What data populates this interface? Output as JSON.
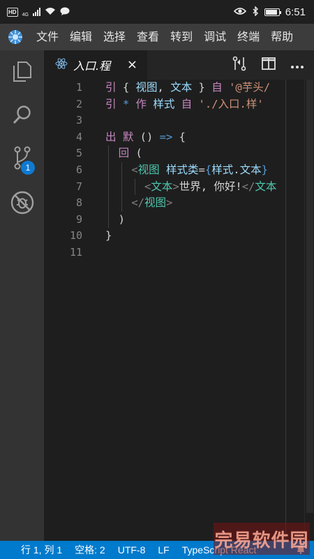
{
  "status_bar": {
    "hd": "HD",
    "network": "4G",
    "time": "6:51",
    "battery_level": 0.9
  },
  "menu": {
    "items": [
      "文件",
      "编辑",
      "选择",
      "查看",
      "转到",
      "调试",
      "终端",
      "帮助"
    ]
  },
  "activity_bar": {
    "items": [
      "explorer-icon",
      "search-icon",
      "source-control-icon",
      "extensions-icon"
    ],
    "scm_badge": "1"
  },
  "tab": {
    "title": "入口.程",
    "close": "×"
  },
  "editor": {
    "line_numbers": [
      "1",
      "2",
      "3",
      "4",
      "5",
      "6",
      "7",
      "8",
      "9",
      "10",
      "11"
    ],
    "lines": [
      [
        [
          "kw",
          "引 "
        ],
        [
          "pun",
          "{ "
        ],
        [
          "var",
          "视图"
        ],
        [
          "pun",
          ", "
        ],
        [
          "var",
          "文本"
        ],
        [
          "pun",
          " } "
        ],
        [
          "kw",
          "自 "
        ],
        [
          "str",
          "'@芋头/"
        ]
      ],
      [
        [
          "kw",
          "引 "
        ],
        [
          "op",
          "* "
        ],
        [
          "kw",
          "作 "
        ],
        [
          "var",
          "样式 "
        ],
        [
          "kw",
          "自 "
        ],
        [
          "str",
          "'./入口.样'"
        ]
      ],
      [],
      [
        [
          "kw",
          "出 默 "
        ],
        [
          "pun",
          "() "
        ],
        [
          "op",
          "=> "
        ],
        [
          "pun",
          "{"
        ]
      ],
      [
        [
          "pun",
          "  "
        ],
        [
          "kw",
          "回 "
        ],
        [
          "pun",
          "("
        ]
      ],
      [
        [
          "pun",
          "    "
        ],
        [
          "brk",
          "<"
        ],
        [
          "tag",
          "视图 "
        ],
        [
          "var",
          "样式类"
        ],
        [
          "pun",
          "="
        ],
        [
          "op",
          "{"
        ],
        [
          "var",
          "样式"
        ],
        [
          "pun",
          "."
        ],
        [
          "var",
          "文本"
        ],
        [
          "op",
          "}"
        ]
      ],
      [
        [
          "pun",
          "      "
        ],
        [
          "brk",
          "<"
        ],
        [
          "tag",
          "文本"
        ],
        [
          "brk",
          ">"
        ],
        [
          "pun",
          "世界, 你好!"
        ],
        [
          "brk",
          "</"
        ],
        [
          "tag",
          "文本"
        ]
      ],
      [
        [
          "pun",
          "    "
        ],
        [
          "brk",
          "</"
        ],
        [
          "tag",
          "视图"
        ],
        [
          "brk",
          ">"
        ]
      ],
      [
        [
          "pun",
          "  )"
        ]
      ],
      [
        [
          "pun",
          "}"
        ]
      ],
      []
    ]
  },
  "status": {
    "position": "行 1, 列 1",
    "indent": "空格: 2",
    "encoding": "UTF-8",
    "eol": "LF",
    "language": "TypeScript React"
  },
  "watermark": "完易软件园",
  "colors": {
    "status_bar_bg": "#007acc",
    "menu_bg": "#3c3c3c",
    "activity_bg": "#333333",
    "editor_bg": "#1e1e1e",
    "keyword": "#c586c0",
    "string": "#ce9178",
    "variable": "#9cdcfe",
    "tag": "#4ec9b0"
  }
}
